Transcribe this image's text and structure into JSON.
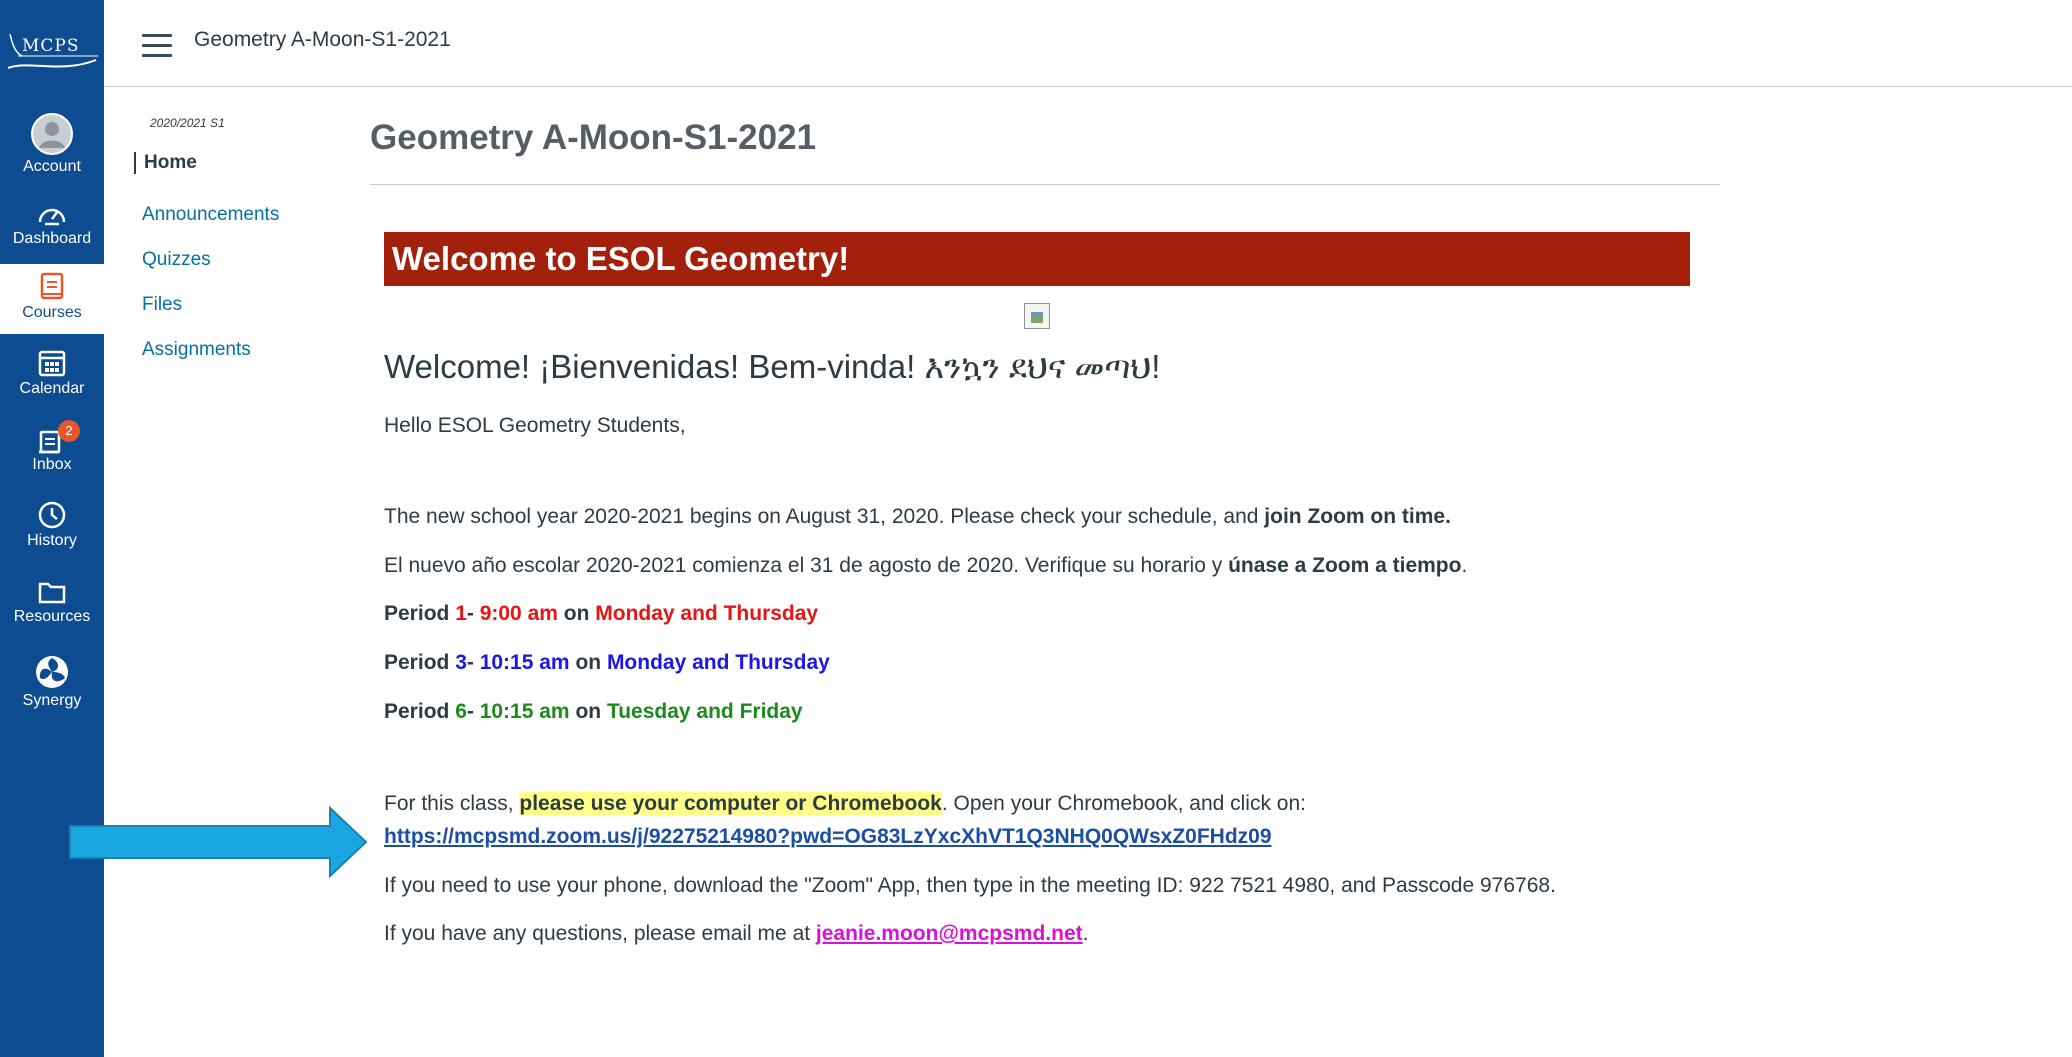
{
  "global_nav": {
    "logo_text": "MCPS",
    "items": [
      {
        "label": "Account",
        "icon": "avatar-icon"
      },
      {
        "label": "Dashboard",
        "icon": "dashboard-icon"
      },
      {
        "label": "Courses",
        "icon": "book-icon"
      },
      {
        "label": "Calendar",
        "icon": "calendar-icon"
      },
      {
        "label": "Inbox",
        "icon": "inbox-icon",
        "badge": "2"
      },
      {
        "label": "History",
        "icon": "clock-icon"
      },
      {
        "label": "Resources",
        "icon": "folder-icon"
      },
      {
        "label": "Synergy",
        "icon": "synergy-icon"
      }
    ]
  },
  "header": {
    "breadcrumb": "Geometry A-Moon-S1-2021"
  },
  "course_nav": {
    "term": "2020/2021 S1",
    "items": [
      "Home",
      "Announcements",
      "Quizzes",
      "Files",
      "Assignments"
    ]
  },
  "main": {
    "page_title": "Geometry A-Moon-S1-2021",
    "banner": "Welcome to ESOL Geometry!",
    "welcome_heading": "Welcome! ¡Bienvenidas! Bem-vinda! እንኳን ደህና መጣህ!",
    "greeting": "Hello ESOL Geometry Students,",
    "en_line": {
      "text": "The new school year 2020-2021 begins on August 31, 2020. Please check your schedule, and ",
      "bold": "join Zoom on time."
    },
    "es_line": {
      "text": "El nuevo año escolar 2020-2021 comienza el 31 de agosto de 2020. Verifique su horario y ",
      "bold": "únase a Zoom a tiempo",
      "end": "."
    },
    "periods": [
      {
        "period_label": "Period ",
        "number": "1",
        "dash": "- ",
        "time": "9:00 am",
        "on": " on ",
        "days": "Monday and Thursday",
        "color": "#e81313"
      },
      {
        "period_label": "Period ",
        "number": "3",
        "dash": "- ",
        "time": "10:15 am",
        "on": " on ",
        "days": "Monday and Thursday",
        "color": "#1c17e8"
      },
      {
        "period_label": "Period ",
        "number": "6",
        "dash": "- ",
        "time": "10:15 am",
        "on": " on ",
        "days": "Tuesday and Friday",
        "color": "#1c8a1c"
      }
    ],
    "class_line": {
      "prefix": "For this class, ",
      "highlight": "please use your computer or Chromebook",
      "suffix": ". Open your Chromebook, and click on:"
    },
    "zoom_link": "https://mcpsmd.zoom.us/j/92275214980?pwd=OG83LzYxcXhVT1Q3NHQ0QWsxZ0FHdz09",
    "phone_line": "If you need to use your phone, download the \"Zoom\" App, then type in the meeting ID: 922 7521 4980, and Passcode  976768.",
    "email_line": {
      "prefix": "If you have any questions, please email me at ",
      "email": "jeanie.moon@mcpsmd.net",
      "end": "."
    }
  },
  "colors": {
    "nav_bg": "#0e4c92",
    "banner_bg": "#a3200c",
    "arrow": "#1aa7e0",
    "link": "#1c4fa3",
    "email": "#d910d9",
    "highlight": "#ffff88"
  }
}
